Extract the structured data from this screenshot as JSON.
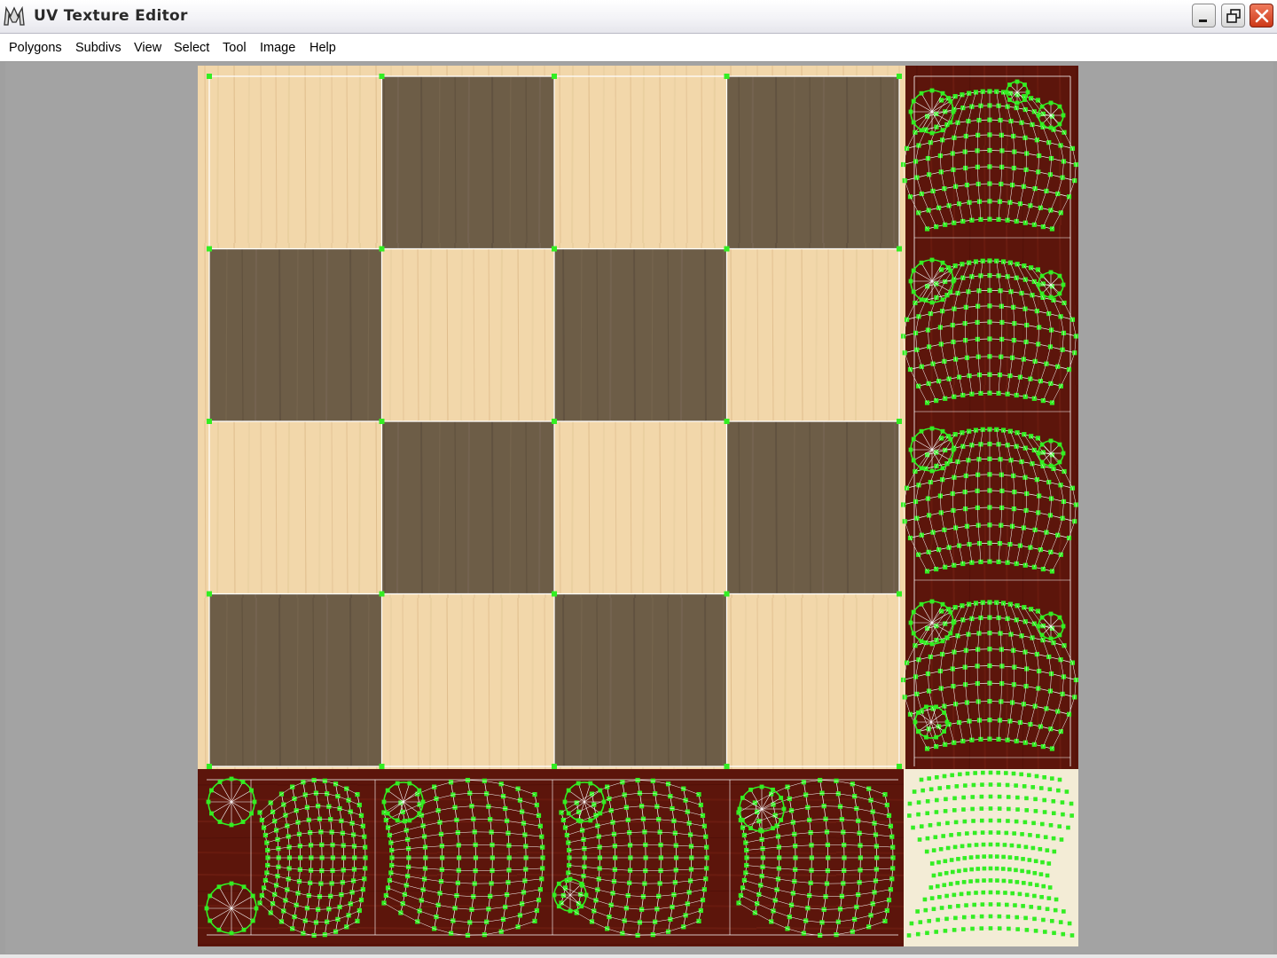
{
  "window": {
    "title": "UV Texture Editor",
    "app_icon": "maya-logo-icon",
    "controls": [
      "minimize-icon",
      "restore-icon",
      "close-icon"
    ]
  },
  "menu": [
    "Polygons",
    "Subdivs",
    "View",
    "Select",
    "Tool",
    "Image",
    "Help"
  ],
  "texture": {
    "board": {
      "rows": 4,
      "cols": 4,
      "light_color": "#f2d7aa",
      "dark_color": "#6e5e48"
    },
    "uv_wire_color": "#ffffff",
    "uv_vertex_color": "#33ee22",
    "piece_strip_color": "#5a1208",
    "corner_swatch_color": "#f3ecd6"
  }
}
